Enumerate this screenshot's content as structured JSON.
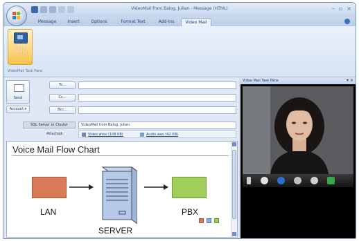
{
  "window": {
    "title": "VideoMail from Balog, Julian - Message (HTML)",
    "controls": [
      "–",
      "▫",
      "×"
    ]
  },
  "tabs": [
    "Message",
    "Insert",
    "Options",
    "Format Text",
    "Add-Ins",
    "Video Mail"
  ],
  "active_tab": "Video Mail",
  "ribbon": {
    "toggle_label_line1": "Toggle",
    "toggle_label_line2": "VideoMail",
    "group_label": "VideoMail Task Pane"
  },
  "compose": {
    "send_label": "Send",
    "account_label": "Account ▾",
    "to_label": "To...",
    "cc_label": "Cc...",
    "bcc_label": "Bcc...",
    "subject_button_label": "SQL Server or Cluster",
    "subject_value": "VideoMail from Balog, Julian.",
    "attached_label": "Attached:",
    "attachments": [
      "Video.wmv (108 KB)",
      "Audio.wav (42 KB)"
    ]
  },
  "chart": {
    "title": "Voice Mail Flow Chart",
    "nodes": [
      "LAN",
      "SERVER",
      "PBX"
    ],
    "colors": {
      "lan": "#d97a57",
      "pbx": "#9fcf5a",
      "legend": [
        "#d97a57",
        "#8fa9d8",
        "#9fcf5a"
      ]
    }
  },
  "video_pane": {
    "title": "Video Mail Task Pane",
    "controls": "▾ ×",
    "toolbar_icons": [
      "microphone-icon",
      "settings-icon",
      "play-icon",
      "record-icon",
      "eject-icon",
      "attach-icon"
    ]
  },
  "accent_colors": {
    "ribbon": "#d6e3f3",
    "toggle": "#ffd77a"
  }
}
